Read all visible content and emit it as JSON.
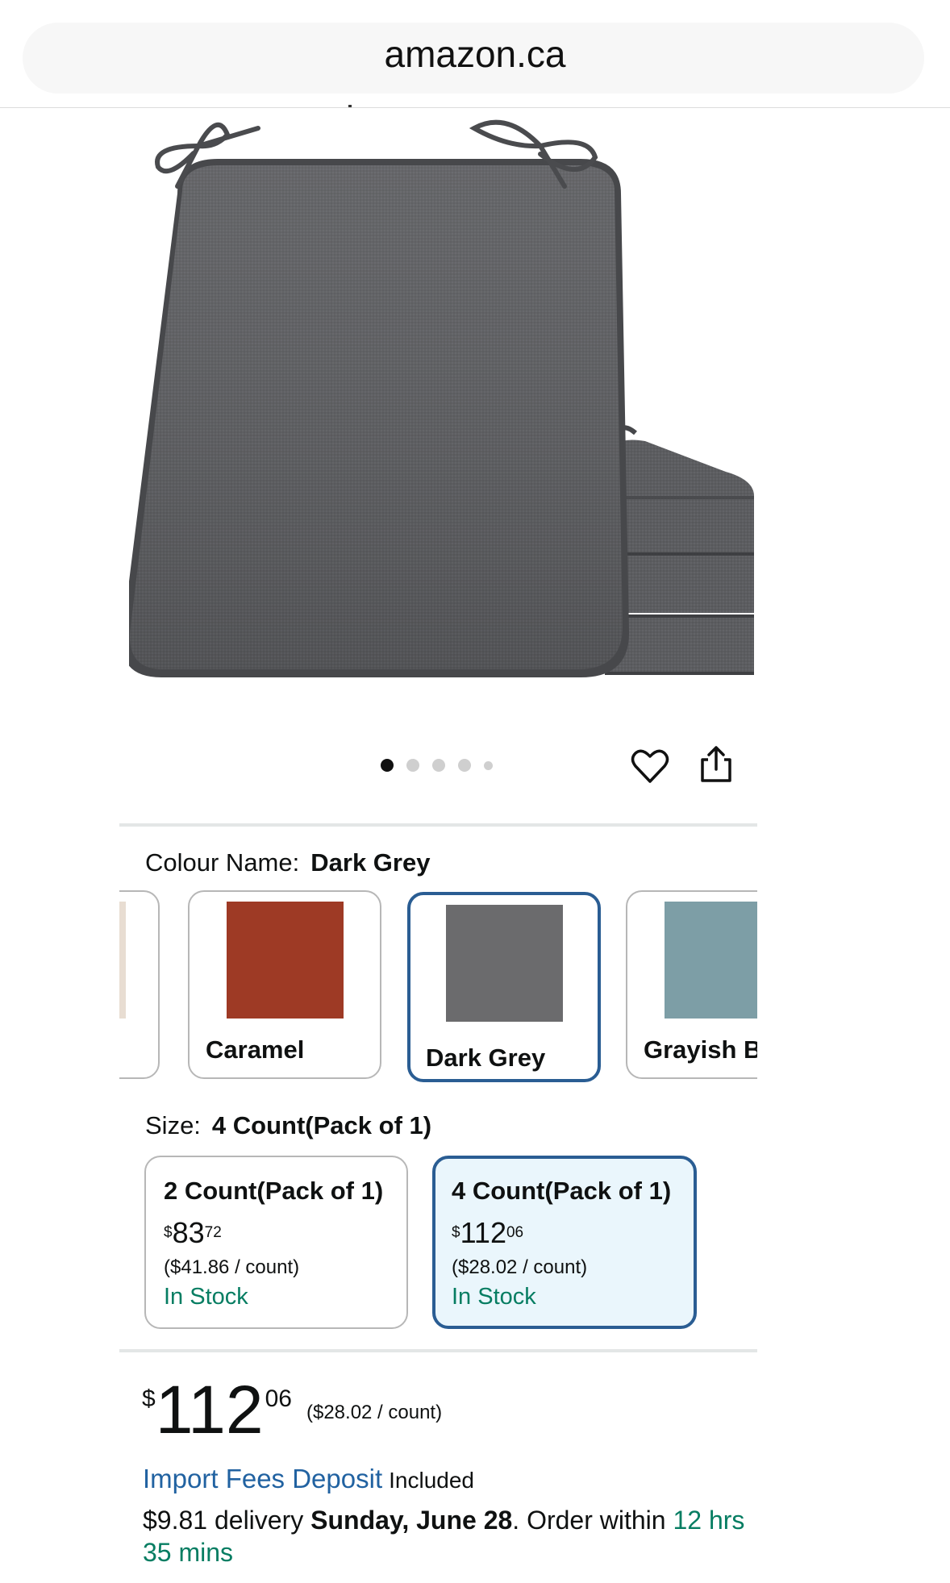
{
  "browser": {
    "url": "amazon.ca"
  },
  "gallery": {
    "image_alt": "Dark grey chair cushion with ties, stacked cushions",
    "dot_count": 5,
    "active_index": 0
  },
  "colour": {
    "label": "Colour Name:",
    "selected": "Dark Grey",
    "options": [
      {
        "name": "",
        "color": "#e8ddd2"
      },
      {
        "name": "Caramel",
        "color": "#9e3a25"
      },
      {
        "name": "Dark Grey",
        "color": "#6b6b6d"
      },
      {
        "name": "Grayish B",
        "color": "#7d9ea6"
      }
    ]
  },
  "size": {
    "label": "Size:",
    "selected": "4 Count(Pack of 1)",
    "options": [
      {
        "title": "2 Count(Pack of 1)",
        "currency": "$",
        "whole": "83",
        "fraction": "72",
        "unit_price": "($41.86 / count)",
        "stock": "In Stock"
      },
      {
        "title": "4 Count(Pack of 1)",
        "currency": "$",
        "whole": "112",
        "fraction": "06",
        "unit_price": "($28.02 / count)",
        "stock": "In Stock"
      }
    ]
  },
  "price": {
    "currency": "$",
    "whole": "112",
    "fraction": "06",
    "unit_price": "($28.02 / count)"
  },
  "import_fees": {
    "link": "Import Fees Deposit",
    "text": "Included"
  },
  "delivery": {
    "cost": "$9.81 delivery",
    "date": "Sunday, June 28",
    "order_within_prefix": ". Order within",
    "timer": "12 hrs 35 mins"
  },
  "colors": {
    "accent": "#2a5d93",
    "link": "#2162a1",
    "stock_green": "#067d62"
  }
}
